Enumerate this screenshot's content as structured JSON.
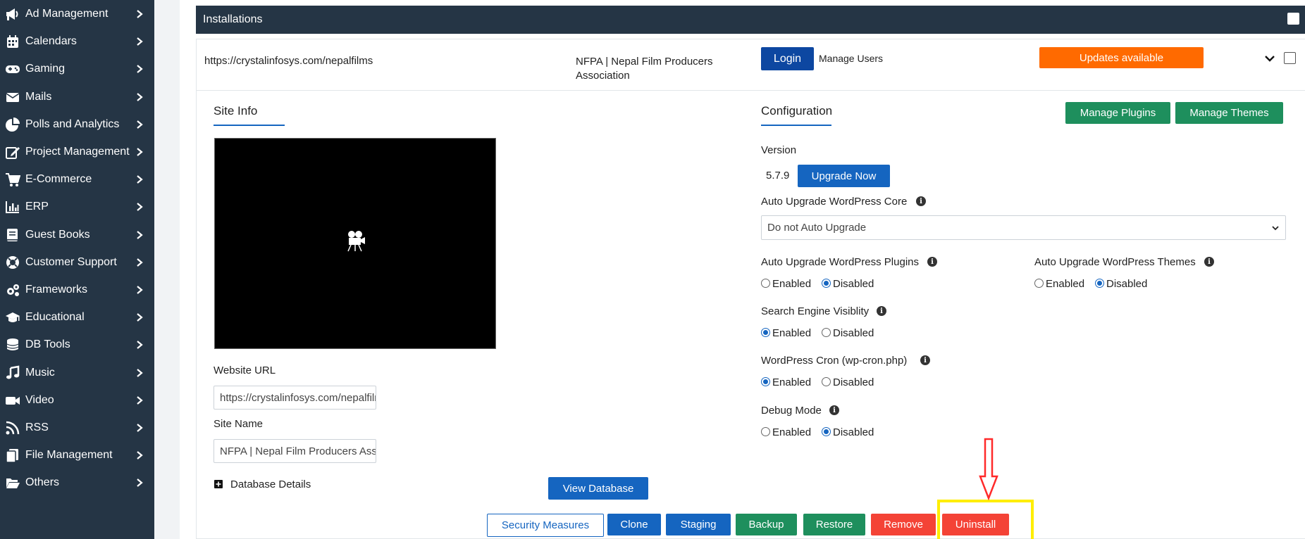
{
  "sidebar": {
    "items": [
      {
        "label": "Ad Management",
        "icon": "megaphone-icon"
      },
      {
        "label": "Calendars",
        "icon": "calendar-icon"
      },
      {
        "label": "Gaming",
        "icon": "gamepad-icon"
      },
      {
        "label": "Mails",
        "icon": "envelope-icon"
      },
      {
        "label": "Polls and Analytics",
        "icon": "pie-chart-icon"
      },
      {
        "label": "Project Management",
        "icon": "edit-icon"
      },
      {
        "label": "E-Commerce",
        "icon": "cart-icon"
      },
      {
        "label": "ERP",
        "icon": "bar-chart-icon"
      },
      {
        "label": "Guest Books",
        "icon": "book-icon"
      },
      {
        "label": "Customer Support",
        "icon": "life-ring-icon"
      },
      {
        "label": "Frameworks",
        "icon": "gears-icon"
      },
      {
        "label": "Educational",
        "icon": "graduation-cap-icon"
      },
      {
        "label": "DB Tools",
        "icon": "database-icon"
      },
      {
        "label": "Music",
        "icon": "music-icon"
      },
      {
        "label": "Video",
        "icon": "video-icon"
      },
      {
        "label": "RSS",
        "icon": "rss-icon"
      },
      {
        "label": "File Management",
        "icon": "files-icon"
      },
      {
        "label": "Others",
        "icon": "folder-open-icon"
      }
    ]
  },
  "header": {
    "title": "Installations"
  },
  "installation": {
    "url": "https://crystalinfosys.com/nepalfilms",
    "site_name_line1": "NFPA | Nepal Film Producers",
    "site_name_line2": "Association",
    "login_label": "Login",
    "manage_users_label": "Manage Users",
    "updates_label": "Updates available"
  },
  "site_info": {
    "tab_label": "Site Info",
    "website_url_label": "Website URL",
    "website_url_value": "https://crystalinfosys.com/nepalfilms",
    "site_name_label": "Site Name",
    "site_name_value": "NFPA | Nepal Film Producers Association",
    "database_details_label": "Database Details",
    "view_database_label": "View Database"
  },
  "configuration": {
    "tab_label": "Configuration",
    "manage_plugins_label": "Manage Plugins",
    "manage_themes_label": "Manage Themes",
    "version_label": "Version",
    "version_value": "5.7.9",
    "upgrade_now_label": "Upgrade Now",
    "auto_core_label": "Auto Upgrade WordPress Core",
    "auto_core_value": "Do not Auto Upgrade",
    "auto_plugins_label": "Auto Upgrade WordPress Plugins",
    "auto_themes_label": "Auto Upgrade WordPress Themes",
    "search_engine_label": "Search Engine Visiblity",
    "wp_cron_label": "WordPress Cron (wp-cron.php)",
    "debug_mode_label": "Debug Mode",
    "enabled_label": "Enabled",
    "disabled_label": "Disabled",
    "auto_plugins_selected": "Disabled",
    "auto_themes_selected": "Disabled",
    "search_engine_selected": "Enabled",
    "wp_cron_selected": "Enabled",
    "debug_mode_selected": "Disabled"
  },
  "actions": {
    "security_label": "Security Measures",
    "clone_label": "Clone",
    "staging_label": "Staging",
    "backup_label": "Backup",
    "restore_label": "Restore",
    "remove_label": "Remove",
    "uninstall_label": "Uninstall"
  },
  "colors": {
    "sidebar_bg": "#253545",
    "primary_blue": "#1565c0",
    "green": "#1e8f5d",
    "red": "#f44336",
    "orange": "#ff6a00",
    "highlight_yellow": "#ffee00",
    "arrow_red": "#ff2a2a"
  }
}
